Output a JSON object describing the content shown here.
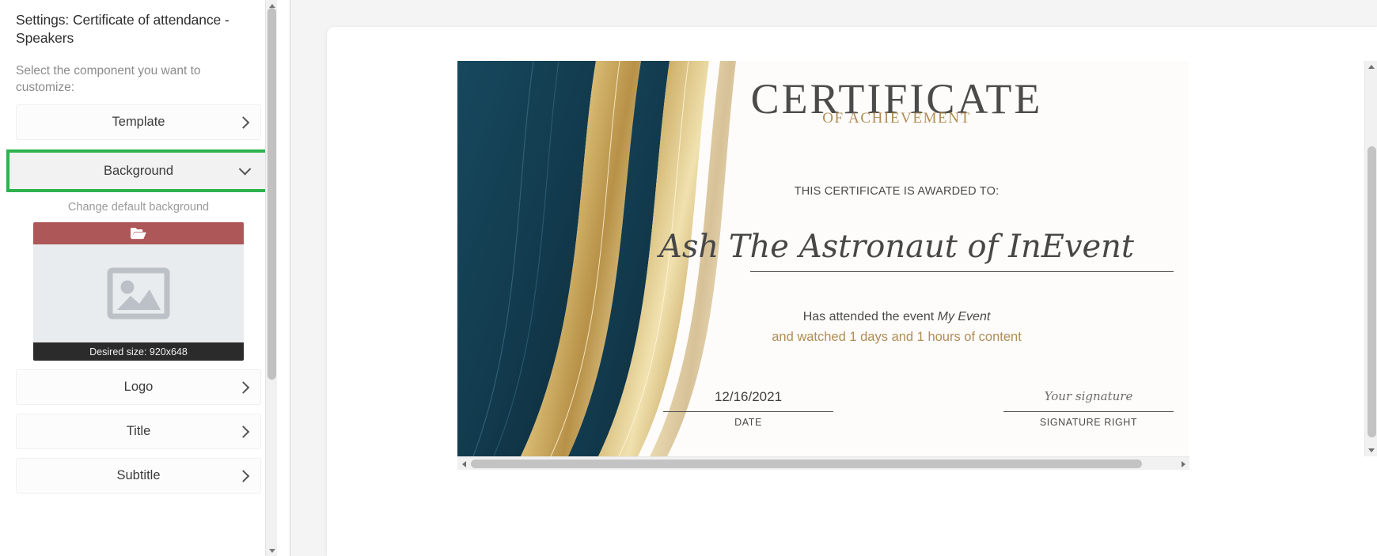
{
  "sidebar": {
    "panel_title": "Settings: Certificate of attendance - Speakers",
    "panel_subtitle": "Select the component you want to customize:",
    "items": [
      {
        "label": "Template",
        "icon": "chevron-right-icon",
        "state": "collapsed"
      },
      {
        "label": "Background",
        "icon": "chevron-down-icon",
        "state": "expanded"
      },
      {
        "label": "Logo",
        "icon": "chevron-right-icon",
        "state": "collapsed"
      },
      {
        "label": "Title",
        "icon": "chevron-right-icon",
        "state": "collapsed"
      },
      {
        "label": "Subtitle",
        "icon": "chevron-right-icon",
        "state": "collapsed"
      }
    ],
    "background_hint": "Change default background",
    "upload": {
      "header_icon": "folder-open-icon",
      "placeholder_icon": "image-placeholder-icon",
      "size_hint": "Desired size: 920x648"
    },
    "highlight_color": "#2eb24e",
    "upload_header_color": "#ae5759",
    "upload_footer_color": "#2b2b2b"
  },
  "certificate": {
    "title": "CERTIFICATE",
    "subtitle": "OF ACHIEVEMENT",
    "awarded_to_label": "THIS CERTIFICATE IS AWARDED TO:",
    "recipient_name": "Ash The Astronaut of InEvent",
    "event_prefix": "Has attended the event",
    "event_name": "My Event",
    "watched_line": "and watched 1 days and 1 hours of content",
    "signature_left": {
      "value": "12/16/2021",
      "label": "DATE"
    },
    "signature_right": {
      "value": "Your signature",
      "label": "SIGNATURE RIGHT"
    },
    "accent_gold": "#b08d54",
    "accent_navy": "#12394d",
    "heading_color": "#4b4b4b"
  }
}
